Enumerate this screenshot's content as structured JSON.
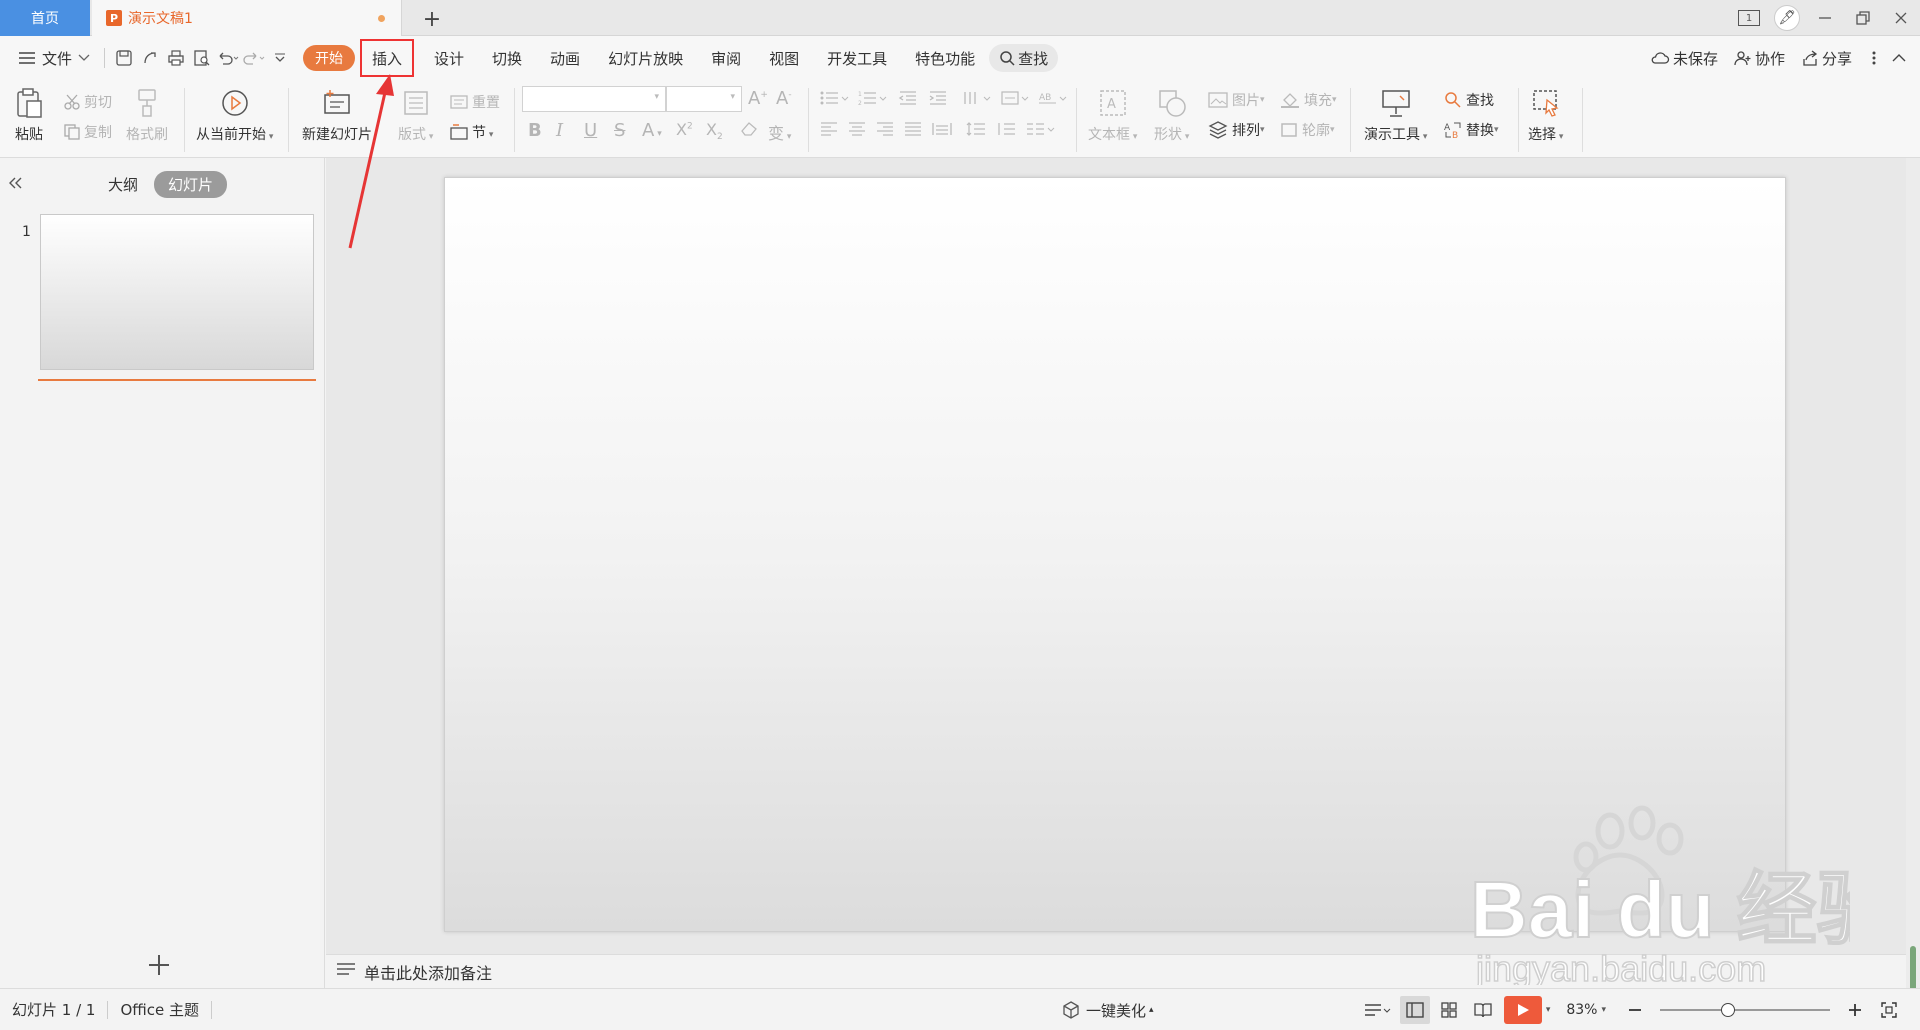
{
  "titlebar": {
    "home_tab": "首页",
    "doc_tab_icon": "P",
    "doc_tab_title": "演示文稿1",
    "new_tab_label": "+",
    "window_badge": "1"
  },
  "menubar": {
    "file_label": "文件",
    "tabs": {
      "start": "开始",
      "insert": "插入",
      "design": "设计",
      "transition": "切换",
      "animation": "动画",
      "slideshow": "幻灯片放映",
      "review": "审阅",
      "view": "视图",
      "developer": "开发工具",
      "special": "特色功能",
      "search": "查找"
    },
    "right": {
      "unsaved": "未保存",
      "collab": "协作",
      "share": "分享"
    }
  },
  "ribbon": {
    "paste": "粘贴",
    "cut": "剪切",
    "copy": "复制",
    "format_painter": "格式刷",
    "from_current": "从当前开始",
    "new_slide": "新建幻灯片",
    "layout": "版式",
    "reset": "重置",
    "section": "节",
    "textbox": "文本框",
    "shape": "形状",
    "picture": "图片",
    "fill": "填充",
    "arrange": "排列",
    "outline": "轮廓",
    "presentation_tools": "演示工具",
    "find": "查找",
    "replace": "替换",
    "select": "选择"
  },
  "leftpanel": {
    "outline_tab": "大纲",
    "slides_tab": "幻灯片",
    "slide_number": "1"
  },
  "notes": {
    "placeholder": "单击此处添加备注"
  },
  "statusbar": {
    "slide_counter": "幻灯片 1 / 1",
    "theme": "Office 主题",
    "beautify": "一键美化",
    "zoom": "83%",
    "zoom_level": 0.4
  },
  "watermark": {
    "brand": "Bai du 经验",
    "url": "jingyan.baidu.com"
  }
}
